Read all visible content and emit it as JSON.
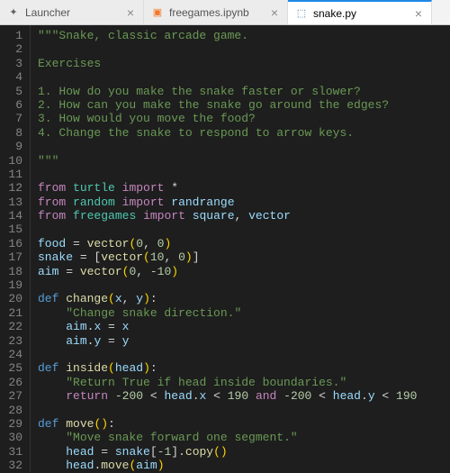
{
  "tabs": [
    {
      "label": "Launcher",
      "icon": "launcher-icon",
      "glyph": "✦",
      "active": false
    },
    {
      "label": "freegames.ipynb",
      "icon": "notebook-icon",
      "glyph": "▣",
      "active": false
    },
    {
      "label": "snake.py",
      "icon": "python-icon",
      "glyph": "⬚",
      "active": true
    }
  ],
  "close_glyph": "×",
  "code_lines": [
    [
      [
        "str",
        "\"\"\"Snake, classic arcade game."
      ]
    ],
    [],
    [
      [
        "str",
        "Exercises"
      ]
    ],
    [],
    [
      [
        "str",
        "1. How do you make the snake faster or slower?"
      ]
    ],
    [
      [
        "str",
        "2. How can you make the snake go around the edges?"
      ]
    ],
    [
      [
        "str",
        "3. How would you move the food?"
      ]
    ],
    [
      [
        "str",
        "4. Change the snake to respond to arrow keys."
      ]
    ],
    [],
    [
      [
        "str",
        "\"\"\""
      ]
    ],
    [],
    [
      [
        "kw",
        "from"
      ],
      [
        "op",
        " "
      ],
      [
        "mod",
        "turtle"
      ],
      [
        "op",
        " "
      ],
      [
        "kw",
        "import"
      ],
      [
        "op",
        " *"
      ]
    ],
    [
      [
        "kw",
        "from"
      ],
      [
        "op",
        " "
      ],
      [
        "mod",
        "random"
      ],
      [
        "op",
        " "
      ],
      [
        "kw",
        "import"
      ],
      [
        "op",
        " "
      ],
      [
        "id",
        "randrange"
      ]
    ],
    [
      [
        "kw",
        "from"
      ],
      [
        "op",
        " "
      ],
      [
        "mod",
        "freegames"
      ],
      [
        "op",
        " "
      ],
      [
        "kw",
        "import"
      ],
      [
        "op",
        " "
      ],
      [
        "id",
        "square"
      ],
      [
        "op",
        ", "
      ],
      [
        "id",
        "vector"
      ]
    ],
    [],
    [
      [
        "id",
        "food"
      ],
      [
        "op",
        " = "
      ],
      [
        "fn",
        "vector"
      ],
      [
        "par",
        "("
      ],
      [
        "num",
        "0"
      ],
      [
        "op",
        ", "
      ],
      [
        "num",
        "0"
      ],
      [
        "par",
        ")"
      ]
    ],
    [
      [
        "id",
        "snake"
      ],
      [
        "op",
        " = ["
      ],
      [
        "fn",
        "vector"
      ],
      [
        "par",
        "("
      ],
      [
        "num",
        "10"
      ],
      [
        "op",
        ", "
      ],
      [
        "num",
        "0"
      ],
      [
        "par",
        ")"
      ],
      [
        "op",
        "]"
      ]
    ],
    [
      [
        "id",
        "aim"
      ],
      [
        "op",
        " = "
      ],
      [
        "fn",
        "vector"
      ],
      [
        "par",
        "("
      ],
      [
        "num",
        "0"
      ],
      [
        "op",
        ", "
      ],
      [
        "num",
        "-10"
      ],
      [
        "par",
        ")"
      ]
    ],
    [],
    [
      [
        "def",
        "def"
      ],
      [
        "op",
        " "
      ],
      [
        "fn",
        "change"
      ],
      [
        "par",
        "("
      ],
      [
        "id",
        "x"
      ],
      [
        "op",
        ", "
      ],
      [
        "id",
        "y"
      ],
      [
        "par",
        ")"
      ],
      [
        "op",
        ":"
      ]
    ],
    [
      [
        "op",
        "    "
      ],
      [
        "str",
        "\"Change snake direction.\""
      ]
    ],
    [
      [
        "op",
        "    "
      ],
      [
        "id",
        "aim"
      ],
      [
        "op",
        "."
      ],
      [
        "id",
        "x"
      ],
      [
        "op",
        " = "
      ],
      [
        "id",
        "x"
      ]
    ],
    [
      [
        "op",
        "    "
      ],
      [
        "id",
        "aim"
      ],
      [
        "op",
        "."
      ],
      [
        "id",
        "y"
      ],
      [
        "op",
        " = "
      ],
      [
        "id",
        "y"
      ]
    ],
    [],
    [
      [
        "def",
        "def"
      ],
      [
        "op",
        " "
      ],
      [
        "fn",
        "inside"
      ],
      [
        "par",
        "("
      ],
      [
        "id",
        "head"
      ],
      [
        "par",
        ")"
      ],
      [
        "op",
        ":"
      ]
    ],
    [
      [
        "op",
        "    "
      ],
      [
        "str",
        "\"Return True if head inside boundaries.\""
      ]
    ],
    [
      [
        "op",
        "    "
      ],
      [
        "kw",
        "return"
      ],
      [
        "op",
        " "
      ],
      [
        "num",
        "-200"
      ],
      [
        "op",
        " < "
      ],
      [
        "id",
        "head"
      ],
      [
        "op",
        "."
      ],
      [
        "id",
        "x"
      ],
      [
        "op",
        " < "
      ],
      [
        "num",
        "190"
      ],
      [
        "op",
        " "
      ],
      [
        "kw",
        "and"
      ],
      [
        "op",
        " "
      ],
      [
        "num",
        "-200"
      ],
      [
        "op",
        " < "
      ],
      [
        "id",
        "head"
      ],
      [
        "op",
        "."
      ],
      [
        "id",
        "y"
      ],
      [
        "op",
        " < "
      ],
      [
        "num",
        "190"
      ]
    ],
    [],
    [
      [
        "def",
        "def"
      ],
      [
        "op",
        " "
      ],
      [
        "fn",
        "move"
      ],
      [
        "par",
        "()"
      ],
      [
        "op",
        ":"
      ]
    ],
    [
      [
        "op",
        "    "
      ],
      [
        "str",
        "\"Move snake forward one segment.\""
      ]
    ],
    [
      [
        "op",
        "    "
      ],
      [
        "id",
        "head"
      ],
      [
        "op",
        " = "
      ],
      [
        "id",
        "snake"
      ],
      [
        "op",
        "["
      ],
      [
        "num",
        "-1"
      ],
      [
        "op",
        "]."
      ],
      [
        "fn",
        "copy"
      ],
      [
        "par",
        "()"
      ]
    ],
    [
      [
        "op",
        "    "
      ],
      [
        "id",
        "head"
      ],
      [
        "op",
        "."
      ],
      [
        "fn",
        "move"
      ],
      [
        "par",
        "("
      ],
      [
        "id",
        "aim"
      ],
      [
        "par",
        ")"
      ]
    ]
  ]
}
